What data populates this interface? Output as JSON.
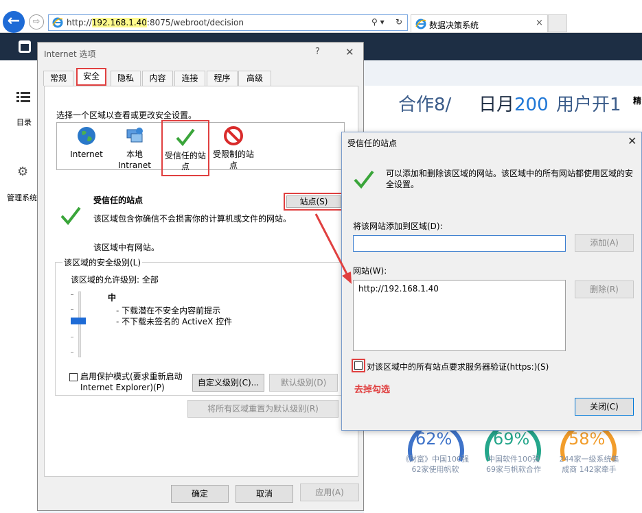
{
  "browser": {
    "back_glyph": "←",
    "forward_glyph": "⇨",
    "address_prefix": "http://",
    "address_host": "192.168.1.40",
    "address_suffix": ":8075/webroot/decision",
    "search_glyph": "⚲ ▾",
    "refresh_glyph": "↻",
    "tab_title": "数据决策系统",
    "tab_close": "×"
  },
  "app": {
    "sidebar_menu_label": "目录",
    "sidebar_mgmt_label": "管理系统",
    "kpi_1": "合作8/",
    "kpi_2_prefix": "日月",
    "kpi_2_value": "200",
    "kpi_3": "用户开1",
    "kpi_4": "精",
    "gauges": [
      {
        "value": "62%",
        "caption_1": "《财富》中国100强",
        "caption_2": "62家使用帆软",
        "color": "#3e73c9"
      },
      {
        "value": "69%",
        "caption_1": "中国软件100强",
        "caption_2": "69家与帆软合作",
        "color": "#25a68b"
      },
      {
        "value": "58%",
        "caption_1": "244家一级系统集",
        "caption_2": "成商 142家牵手",
        "color": "#f29d2b"
      }
    ]
  },
  "internet_options": {
    "title": "Internet 选项",
    "help": "?",
    "close": "✕",
    "tabs": {
      "general": "常规",
      "security": "安全",
      "privacy": "隐私",
      "content": "内容",
      "connections": "连接",
      "programs": "程序",
      "advanced": "高级"
    },
    "zone_prompt": "选择一个区域以查看或更改安全设置。",
    "zones": {
      "internet": "Internet",
      "local_1": "本地",
      "local_2": "Intranet",
      "trusted_1": "受信任的站",
      "trusted_2": "点",
      "restricted_1": "受限制的站",
      "restricted_2": "点"
    },
    "trusted_title": "受信任的站点",
    "trusted_desc": "该区域包含你确信不会损害你的计算机或文件的网站。",
    "trusted_note": "该区域中有网站。",
    "sites_button": "站点(S)",
    "level_group": "该区域的安全级别(L)",
    "allowed_level": "该区域的允许级别: 全部",
    "level_name": "中",
    "bullet_1": "- 下载潜在不安全内容前提示",
    "bullet_2": "- 不下载未签名的 ActiveX 控件",
    "protect_line_1": "启用保护模式(要求重新启动",
    "protect_line_2": "Internet Explorer)(P)",
    "custom_level": "自定义级别(C)...",
    "default_level": "默认级别(D)",
    "reset_all": "将所有区域重置为默认级别(R)",
    "ok": "确定",
    "cancel": "取消",
    "apply": "应用(A)"
  },
  "trusted_sites": {
    "title": "受信任的站点",
    "close": "✕",
    "description": "可以添加和删除该区域的网站。该区域中的所有网站都使用区域的安全设置。",
    "add_label": "将该网站添加到区域(D):",
    "add_value": "",
    "add_button": "添加(A)",
    "sites_label": "网站(W):",
    "sites": [
      "http://192.168.1.40"
    ],
    "remove_button": "删除(R)",
    "https_label": "对该区域中的所有站点要求服务器验证(https:)(S)",
    "https_checked": false,
    "annotation": "去掉勾选",
    "close_button": "关闭(C)"
  },
  "colors": {
    "accent": "#1e6bd6",
    "annotation_red": "#e04040",
    "app_header": "#1d2e44"
  }
}
